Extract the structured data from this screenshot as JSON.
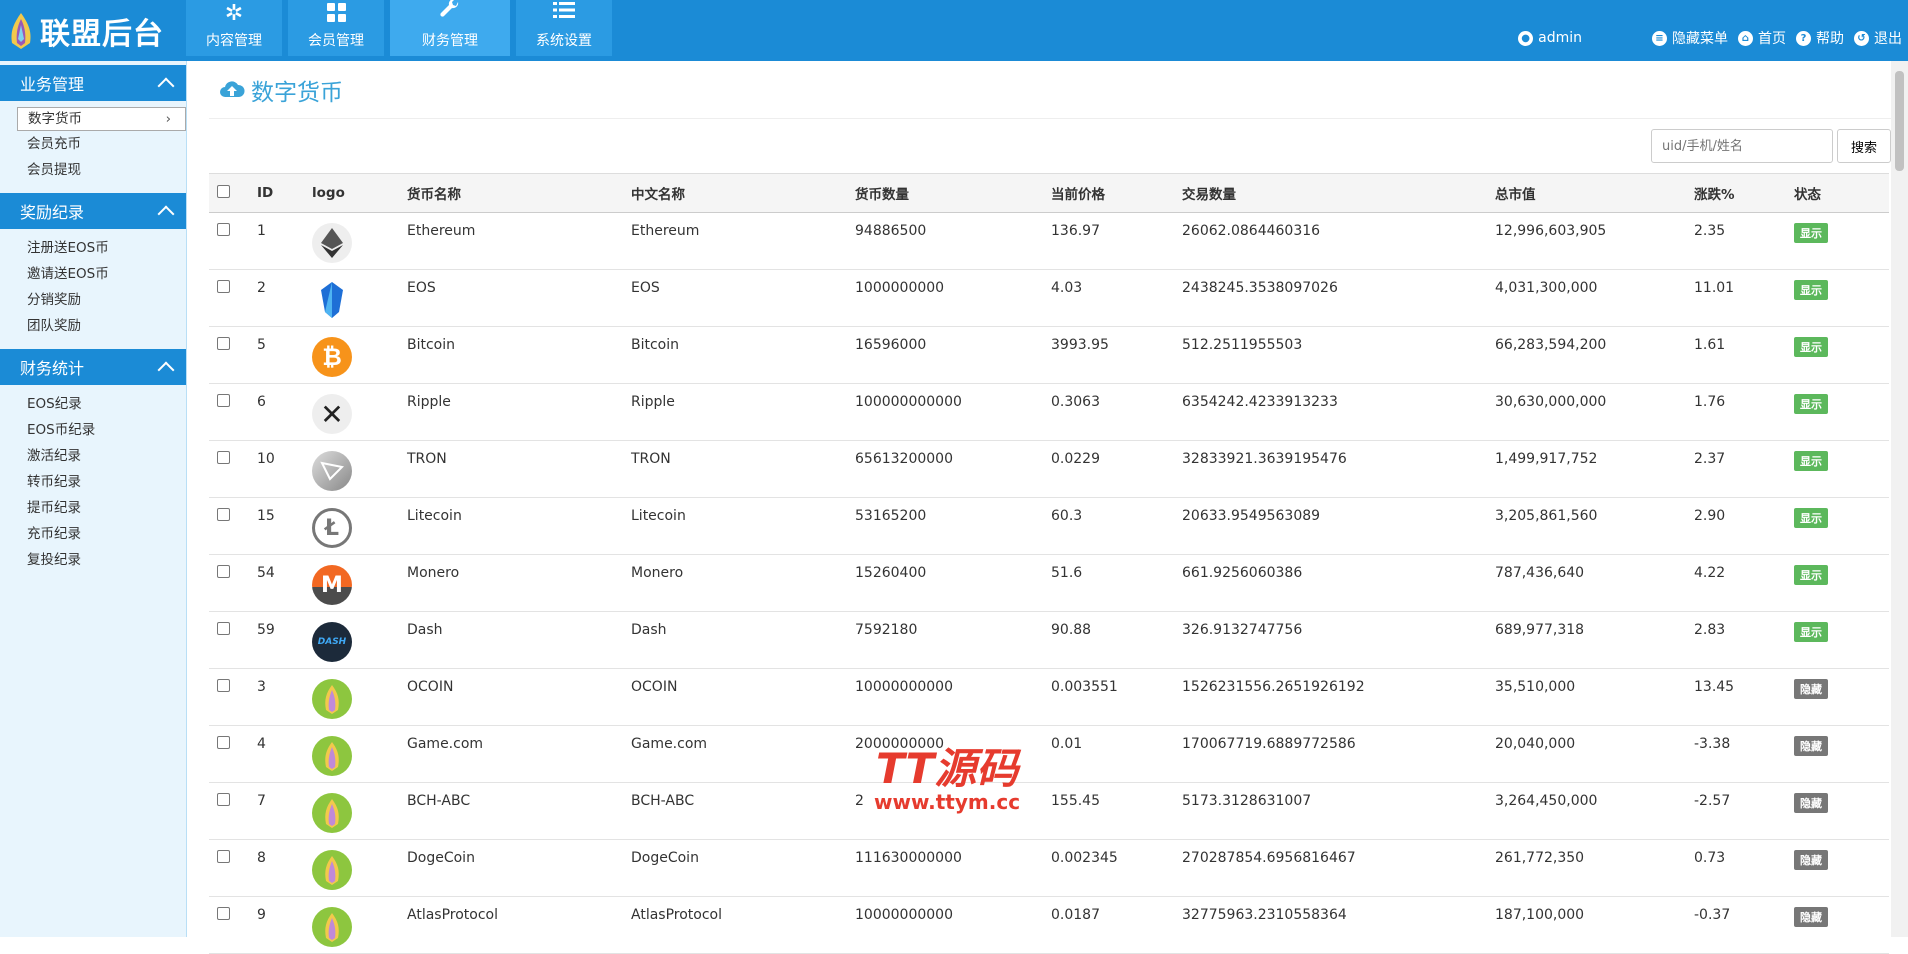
{
  "app": {
    "title": "联盟后台"
  },
  "topnav": [
    {
      "label": "内容管理",
      "icon": "snowflake-icon"
    },
    {
      "label": "会员管理",
      "icon": "grid-icon"
    },
    {
      "label": "财务管理",
      "icon": "wrench-icon",
      "active": true
    },
    {
      "label": "系统设置",
      "icon": "list-icon"
    }
  ],
  "toplinks": {
    "admin": "admin",
    "hide_menu": "隐藏菜单",
    "home": "首页",
    "help": "帮助",
    "logout": "退出"
  },
  "sidebar": {
    "groups": [
      {
        "title": "业务管理",
        "items": [
          "数字货币",
          "会员充币",
          "会员提现"
        ]
      },
      {
        "title": "奖励纪录",
        "items": [
          "注册送EOS币",
          "邀请送EOS币",
          "分销奖励",
          "团队奖励"
        ]
      },
      {
        "title": "财务统计",
        "items": [
          "EOS纪录",
          "EOS币纪录",
          "激活纪录",
          "转币纪录",
          "提币纪录",
          "充币纪录",
          "复投纪录"
        ]
      }
    ]
  },
  "page": {
    "title": "数字货币"
  },
  "search": {
    "placeholder": "uid/手机/姓名",
    "button": "搜索"
  },
  "table": {
    "columns": [
      "ID",
      "logo",
      "货币名称",
      "中文名称",
      "货币数量",
      "当前价格",
      "交易数量",
      "总市值",
      "涨跌%",
      "状态"
    ],
    "rows": [
      {
        "id": "1",
        "logo": "ethereum",
        "name": "Ethereum",
        "cn": "Ethereum",
        "qty": "94886500",
        "price": "136.97",
        "vol": "26062.0864460316",
        "cap": "12,996,603,905",
        "chg": "2.35",
        "status": "显示"
      },
      {
        "id": "2",
        "logo": "eos",
        "name": "EOS",
        "cn": "EOS",
        "qty": "1000000000",
        "price": "4.03",
        "vol": "2438245.3538097026",
        "cap": "4,031,300,000",
        "chg": "11.01",
        "status": "显示"
      },
      {
        "id": "5",
        "logo": "bitcoin",
        "name": "Bitcoin",
        "cn": "Bitcoin",
        "qty": "16596000",
        "price": "3993.95",
        "vol": "512.2511955503",
        "cap": "66,283,594,200",
        "chg": "1.61",
        "status": "显示"
      },
      {
        "id": "6",
        "logo": "ripple",
        "name": "Ripple",
        "cn": "Ripple",
        "qty": "100000000000",
        "price": "0.3063",
        "vol": "6354242.4233913233",
        "cap": "30,630,000,000",
        "chg": "1.76",
        "status": "显示"
      },
      {
        "id": "10",
        "logo": "tron",
        "name": "TRON",
        "cn": "TRON",
        "qty": "65613200000",
        "price": "0.0229",
        "vol": "32833921.3639195476",
        "cap": "1,499,917,752",
        "chg": "2.37",
        "status": "显示"
      },
      {
        "id": "15",
        "logo": "litecoin",
        "name": "Litecoin",
        "cn": "Litecoin",
        "qty": "53165200",
        "price": "60.3",
        "vol": "20633.9549563089",
        "cap": "3,205,861,560",
        "chg": "2.90",
        "status": "显示"
      },
      {
        "id": "54",
        "logo": "monero",
        "name": "Monero",
        "cn": "Monero",
        "qty": "15260400",
        "price": "51.6",
        "vol": "661.9256060386",
        "cap": "787,436,640",
        "chg": "4.22",
        "status": "显示"
      },
      {
        "id": "59",
        "logo": "dash",
        "name": "Dash",
        "cn": "Dash",
        "qty": "7592180",
        "price": "90.88",
        "vol": "326.9132747756",
        "cap": "689,977,318",
        "chg": "2.83",
        "status": "显示"
      },
      {
        "id": "3",
        "logo": "default",
        "name": "OCOIN",
        "cn": "OCOIN",
        "qty": "10000000000",
        "price": "0.003551",
        "vol": "1526231556.2651926192",
        "cap": "35,510,000",
        "chg": "13.45",
        "status": "隐藏"
      },
      {
        "id": "4",
        "logo": "default",
        "name": "Game.com",
        "cn": "Game.com",
        "qty": "2000000000",
        "price": "0.01",
        "vol": "170067719.6889772586",
        "cap": "20,040,000",
        "chg": "-3.38",
        "status": "隐藏"
      },
      {
        "id": "7",
        "logo": "default",
        "name": "BCH-ABC",
        "cn": "BCH-ABC",
        "qty": "2",
        "price": "155.45",
        "vol": "5173.3128631007",
        "cap": "3,264,450,000",
        "chg": "-2.57",
        "status": "隐藏"
      },
      {
        "id": "8",
        "logo": "default",
        "name": "DogeCoin",
        "cn": "DogeCoin",
        "qty": "111630000000",
        "price": "0.002345",
        "vol": "270287854.6956816467",
        "cap": "261,772,350",
        "chg": "0.73",
        "status": "隐藏"
      },
      {
        "id": "9",
        "logo": "default",
        "name": "AtlasProtocol",
        "cn": "AtlasProtocol",
        "qty": "10000000000",
        "price": "0.0187",
        "vol": "32775963.2310558364",
        "cap": "187,100,000",
        "chg": "-0.37",
        "status": "隐藏"
      }
    ]
  },
  "colors": {
    "primary": "#1b8bd6",
    "show": "#5cb85c",
    "hide": "#777777",
    "watermark": "#e63b2e"
  },
  "watermark": {
    "line1": "TT源码",
    "line2": "www.ttym.cc"
  }
}
